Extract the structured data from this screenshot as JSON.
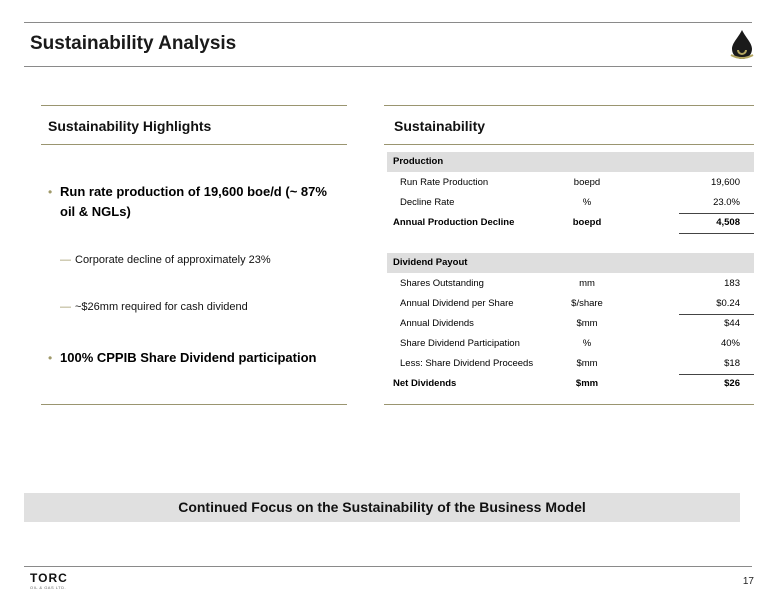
{
  "header": {
    "title": "Sustainability Analysis"
  },
  "left_panel": {
    "heading": "Sustainability Highlights",
    "bullets": [
      "Run rate production of 19,600 boe/d (~ 87% oil & NGLs)",
      "100% CPPIB Share Dividend participation"
    ],
    "sub_items": [
      "Corporate decline of approximately 23%",
      "~$26mm required for cash dividend"
    ],
    "dash_glyph": "—"
  },
  "right_panel": {
    "heading": "Sustainability",
    "sections": [
      {
        "label": "Production",
        "rows": [
          {
            "label": "Run Rate Production",
            "unit": "boepd",
            "value": "19,600"
          },
          {
            "label": "Decline Rate",
            "unit": "%",
            "value": "23.0%"
          },
          {
            "label": "Annual Production Decline",
            "unit": "boepd",
            "value": "4,508"
          }
        ]
      },
      {
        "label": "Dividend Payout",
        "rows": [
          {
            "label": "Shares Outstanding",
            "unit": "mm",
            "value": "183"
          },
          {
            "label": "Annual Dividend per Share",
            "unit": "$/share",
            "value": "$0.24"
          },
          {
            "label": "Annual Dividends",
            "unit": "$mm",
            "value": "$44"
          },
          {
            "label": "Share Dividend Participation",
            "unit": "%",
            "value": "40%"
          },
          {
            "label": "Less: Share Dividend Proceeds",
            "unit": "$mm",
            "value": "$18"
          },
          {
            "label": "Net Dividends",
            "unit": "$mm",
            "value": "$26"
          }
        ]
      }
    ]
  },
  "banner": {
    "text": "Continued Focus on the Sustainability of the Business Model"
  },
  "footer": {
    "logo_text": "TORC",
    "logo_subtext": "OIL & GAS LTD.",
    "page_number": "17"
  },
  "colors": {
    "accent": "#a09a6a",
    "section_fill": "#dedede",
    "banner_fill": "#e0e0e0"
  },
  "icons": {
    "header_logo": "oil-drop-logo-icon",
    "bullet": "bullet-dot-icon"
  }
}
